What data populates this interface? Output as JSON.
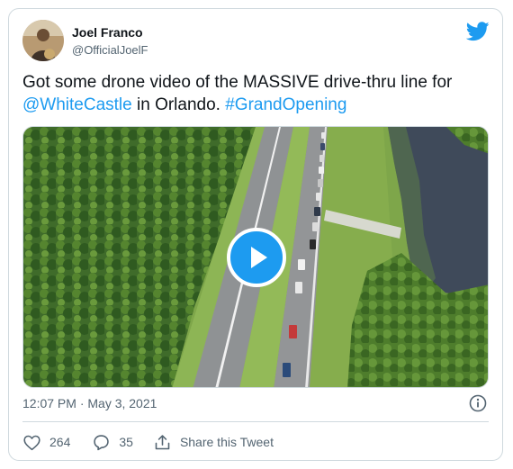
{
  "author": {
    "name": "Joel Franco",
    "handle": "@OfficialJoelF"
  },
  "tweet": {
    "text_line1": "Got some drone video of the MASSIVE drive-thru line for",
    "mention": "@WhiteCastle",
    "text_middle": " in Orlando. ",
    "hashtag": "#GrandOpening"
  },
  "meta": {
    "timestamp": "12:07 PM · May 3, 2021"
  },
  "actions": {
    "likes": "264",
    "replies": "35",
    "share_label": "Share this Tweet"
  },
  "icons": {
    "logo": "twitter-bird-icon",
    "play": "play-icon",
    "info": "info-icon",
    "like": "heart-icon",
    "reply": "reply-bubble-icon",
    "share": "share-icon"
  },
  "colors": {
    "accent": "#1d9bf0",
    "text": "#0f1419",
    "secondary": "#536471",
    "border": "#cfd9de"
  }
}
